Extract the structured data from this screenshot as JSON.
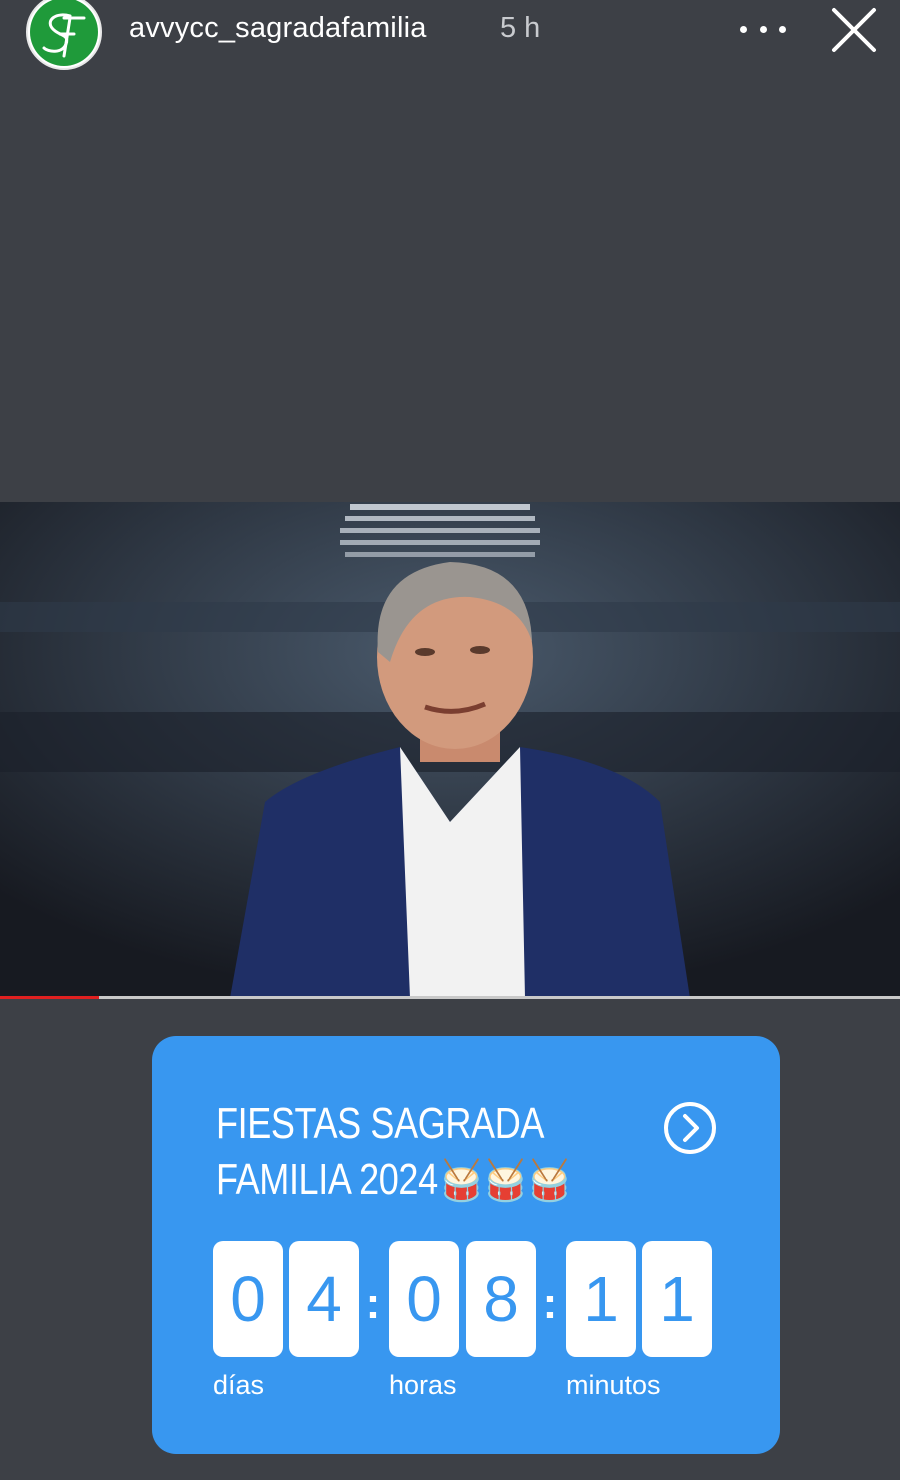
{
  "header": {
    "avatar_text": "SF",
    "username": "avvycc_sagradafamilia",
    "time": "5 h",
    "more_icon": "more-icon",
    "close_icon": "close-icon"
  },
  "video": {
    "progress": 0.11
  },
  "countdown_card": {
    "title_line1": "FIESTAS SAGRADA",
    "title_line2": "FAMILIA 2024",
    "emoji": "🥁🥁🥁",
    "days_digits": [
      "0",
      "4"
    ],
    "hours_digits": [
      "0",
      "8"
    ],
    "minutes_digits": [
      "1",
      "1"
    ],
    "separator": ":",
    "labels": {
      "days": "días",
      "hours": "horas",
      "minutes": "minutos"
    },
    "accent_color": "#3897f0"
  }
}
